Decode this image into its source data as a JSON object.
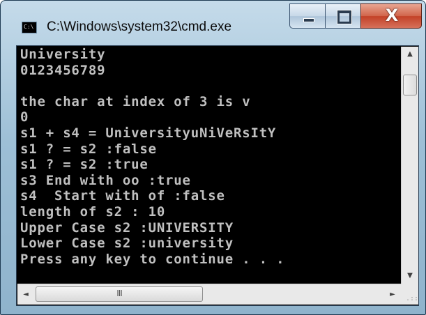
{
  "window": {
    "title": "C:\\Windows\\system32\\cmd.exe",
    "icon_name": "cmd-app-icon",
    "icon_glyph": "C:\\",
    "buttons": {
      "minimize": "minimize-icon",
      "maximize": "maximize-icon",
      "close": "close-icon",
      "close_glyph": "X"
    }
  },
  "console": {
    "lines": [
      "University",
      "0123456789",
      "",
      "the char at index of 3 is v",
      "0",
      "s1 + s4 = UniversityuNiVeRsItY",
      "s1 ? = s2 :false",
      "s1 ? = s2 :true",
      "s3 End with oo :true",
      "s4  Start with of :false",
      "length of s2 : 10",
      "Upper Case s2 :UNIVERSITY",
      "Lower Case s2 :university",
      "Press any key to continue . . ."
    ],
    "text_color": "#c0c0c0",
    "background_color": "#000000"
  },
  "scrollbars": {
    "vertical": {
      "up_glyph": "▲",
      "down_glyph": "▼"
    },
    "horizontal": {
      "left_glyph": "◄",
      "right_glyph": "►",
      "thumb_grip": "III"
    },
    "size_grip": ".::"
  }
}
